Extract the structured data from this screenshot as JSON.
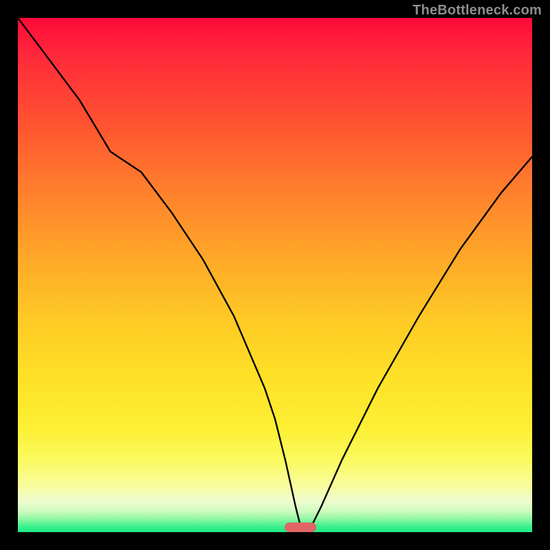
{
  "watermark": "TheBottleneck.com",
  "colors": {
    "frame": "#000000",
    "curve": "#000000",
    "pill": "#e06666",
    "gradient_top": "#ff0a3a",
    "gradient_mid": "#fee126",
    "gradient_bottom": "#1eec88"
  },
  "chart_data": {
    "type": "line",
    "title": "",
    "xlabel": "",
    "ylabel": "",
    "xlim": [
      0,
      100
    ],
    "ylim": [
      0,
      100
    ],
    "grid": false,
    "legend": false,
    "annotations": [],
    "series": [
      {
        "name": "bottleneck-curve",
        "x": [
          0,
          6,
          12,
          18,
          24,
          30,
          36,
          42,
          48,
          50,
          52,
          54,
          55,
          56,
          57,
          59,
          63,
          70,
          78,
          86,
          94,
          100
        ],
        "values": [
          100,
          92,
          84,
          74,
          70,
          62,
          53,
          42,
          28,
          22,
          14,
          5,
          1,
          0,
          1,
          5,
          14,
          28,
          42,
          55,
          66,
          73
        ]
      }
    ],
    "marker": {
      "name": "optimal-point",
      "x": 55,
      "y": 0,
      "shape": "pill",
      "color": "#e06666"
    }
  }
}
